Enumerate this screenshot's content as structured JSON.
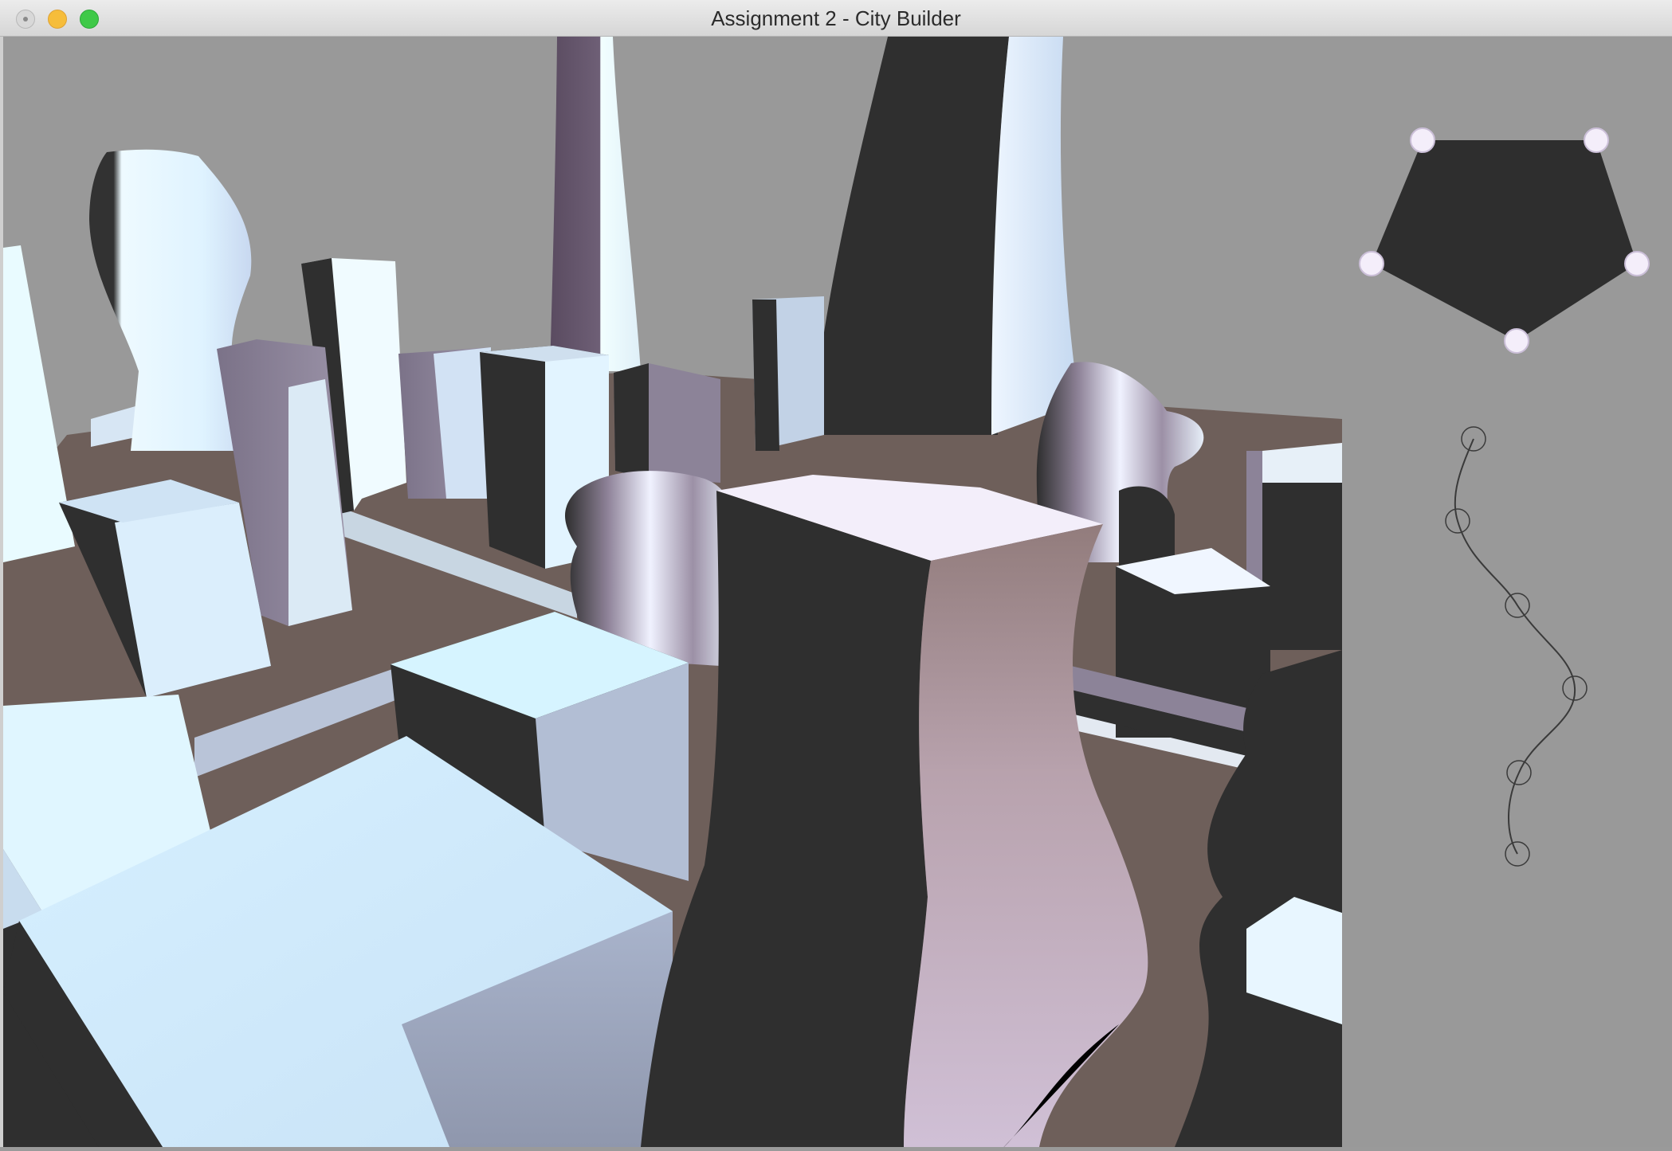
{
  "window": {
    "title": "Assignment 2 - City Builder",
    "buttons": [
      "close",
      "minimize",
      "zoom"
    ]
  },
  "scene": {
    "background_color": "#999999",
    "ground_color": "#6e5f5a",
    "description_icons": [
      "3d-city-viewport"
    ]
  },
  "side_panel": {
    "footprint_editor": {
      "shape": "pentagon",
      "vertex_count": 5,
      "fill_color": "#2e2e2e",
      "handle_color": "#f4eefa"
    },
    "profile_curve_editor": {
      "control_point_count": 6,
      "curve_color": "#3a3a3a"
    }
  }
}
